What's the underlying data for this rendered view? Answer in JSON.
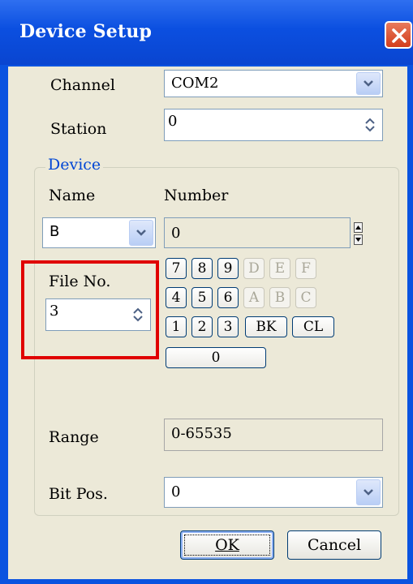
{
  "window": {
    "title": "Device Setup"
  },
  "channel": {
    "label": "Channel",
    "value": "COM2"
  },
  "station": {
    "label": "Station",
    "value": "0"
  },
  "device_group": {
    "label": "Device"
  },
  "name": {
    "label": "Name",
    "value": "B"
  },
  "number": {
    "label": "Number",
    "value": "0"
  },
  "file_no": {
    "label": "File No.",
    "value": "3"
  },
  "keypad": {
    "row1": [
      "7",
      "8",
      "9",
      "D",
      "E",
      "F"
    ],
    "row2": [
      "4",
      "5",
      "6",
      "A",
      "B",
      "C"
    ],
    "row3": [
      "1",
      "2",
      "3",
      "BK",
      "CL"
    ],
    "zero": "0"
  },
  "range": {
    "label": "Range",
    "value": "0-65535"
  },
  "bit_pos": {
    "label": "Bit Pos.",
    "value": "0"
  },
  "buttons": {
    "ok": "OK",
    "cancel": "Cancel"
  },
  "colors": {
    "title_bar": "#0a53e0",
    "dialog_bg": "#ece9d8",
    "highlight": "#e00000",
    "group_label": "#0046d5"
  }
}
